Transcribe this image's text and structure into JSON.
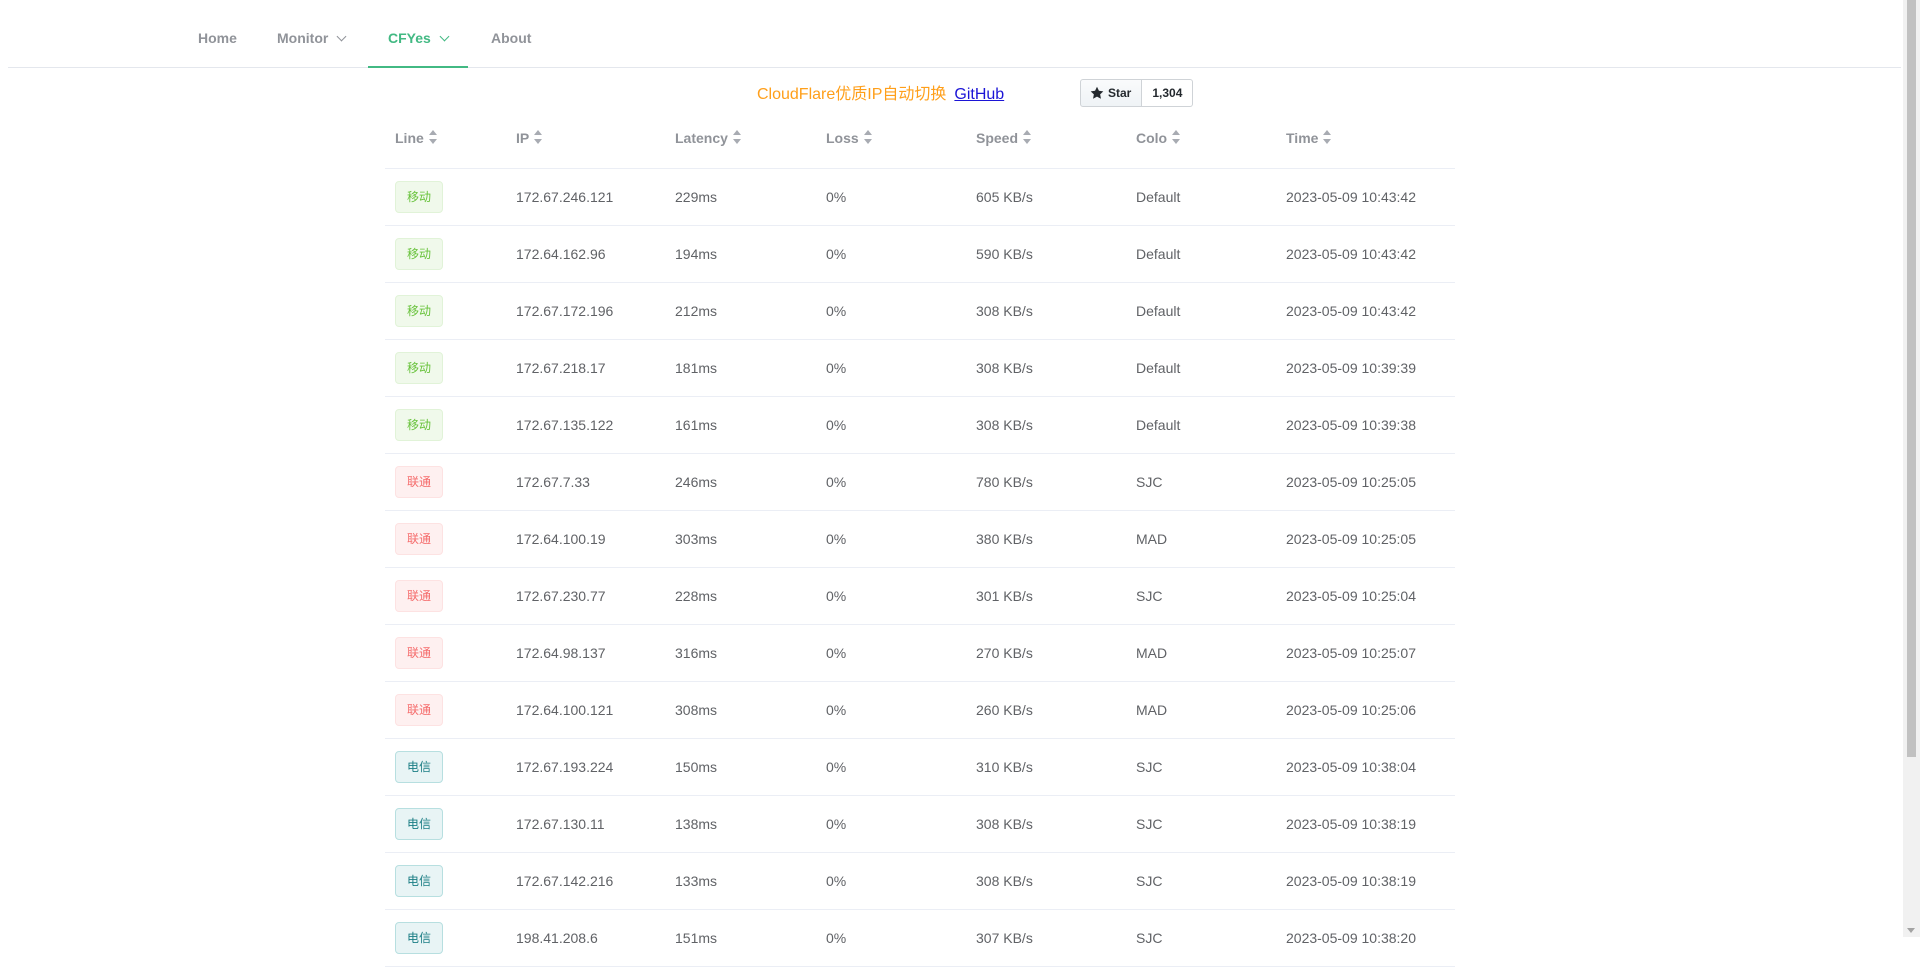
{
  "nav": {
    "items": [
      {
        "label": "Home",
        "dropdown": false,
        "active": false
      },
      {
        "label": "Monitor",
        "dropdown": true,
        "active": false
      },
      {
        "label": "CFYes",
        "dropdown": true,
        "active": true
      },
      {
        "label": "About",
        "dropdown": false,
        "active": false
      }
    ]
  },
  "header": {
    "title": "CloudFlare优质IP自动切换",
    "github_link": "GitHub",
    "star_label": "Star",
    "star_count": "1,304"
  },
  "colors": {
    "accent": "#42b983",
    "title": "#ff9f1a",
    "tag_green": "#67c23a",
    "tag_red": "#f56c6c",
    "tag_teal": "#1a7d84"
  },
  "table": {
    "columns": [
      "Line",
      "IP",
      "Latency",
      "Loss",
      "Speed",
      "Colo",
      "Time"
    ],
    "rows": [
      {
        "line": "移动",
        "tag": "green",
        "ip": "172.67.246.121",
        "latency": "229ms",
        "loss": "0%",
        "speed": "605 KB/s",
        "colo": "Default",
        "time": "2023-05-09 10:43:42"
      },
      {
        "line": "移动",
        "tag": "green",
        "ip": "172.64.162.96",
        "latency": "194ms",
        "loss": "0%",
        "speed": "590 KB/s",
        "colo": "Default",
        "time": "2023-05-09 10:43:42"
      },
      {
        "line": "移动",
        "tag": "green",
        "ip": "172.67.172.196",
        "latency": "212ms",
        "loss": "0%",
        "speed": "308 KB/s",
        "colo": "Default",
        "time": "2023-05-09 10:43:42"
      },
      {
        "line": "移动",
        "tag": "green",
        "ip": "172.67.218.17",
        "latency": "181ms",
        "loss": "0%",
        "speed": "308 KB/s",
        "colo": "Default",
        "time": "2023-05-09 10:39:39"
      },
      {
        "line": "移动",
        "tag": "green",
        "ip": "172.67.135.122",
        "latency": "161ms",
        "loss": "0%",
        "speed": "308 KB/s",
        "colo": "Default",
        "time": "2023-05-09 10:39:38"
      },
      {
        "line": "联通",
        "tag": "red",
        "ip": "172.67.7.33",
        "latency": "246ms",
        "loss": "0%",
        "speed": "780 KB/s",
        "colo": "SJC",
        "time": "2023-05-09 10:25:05"
      },
      {
        "line": "联通",
        "tag": "red",
        "ip": "172.64.100.19",
        "latency": "303ms",
        "loss": "0%",
        "speed": "380 KB/s",
        "colo": "MAD",
        "time": "2023-05-09 10:25:05"
      },
      {
        "line": "联通",
        "tag": "red",
        "ip": "172.67.230.77",
        "latency": "228ms",
        "loss": "0%",
        "speed": "301 KB/s",
        "colo": "SJC",
        "time": "2023-05-09 10:25:04"
      },
      {
        "line": "联通",
        "tag": "red",
        "ip": "172.64.98.137",
        "latency": "316ms",
        "loss": "0%",
        "speed": "270 KB/s",
        "colo": "MAD",
        "time": "2023-05-09 10:25:07"
      },
      {
        "line": "联通",
        "tag": "red",
        "ip": "172.64.100.121",
        "latency": "308ms",
        "loss": "0%",
        "speed": "260 KB/s",
        "colo": "MAD",
        "time": "2023-05-09 10:25:06"
      },
      {
        "line": "电信",
        "tag": "teal",
        "ip": "172.67.193.224",
        "latency": "150ms",
        "loss": "0%",
        "speed": "310 KB/s",
        "colo": "SJC",
        "time": "2023-05-09 10:38:04"
      },
      {
        "line": "电信",
        "tag": "teal",
        "ip": "172.67.130.11",
        "latency": "138ms",
        "loss": "0%",
        "speed": "308 KB/s",
        "colo": "SJC",
        "time": "2023-05-09 10:38:19"
      },
      {
        "line": "电信",
        "tag": "teal",
        "ip": "172.67.142.216",
        "latency": "133ms",
        "loss": "0%",
        "speed": "308 KB/s",
        "colo": "SJC",
        "time": "2023-05-09 10:38:19"
      },
      {
        "line": "电信",
        "tag": "teal",
        "ip": "198.41.208.6",
        "latency": "151ms",
        "loss": "0%",
        "speed": "307 KB/s",
        "colo": "SJC",
        "time": "2023-05-09 10:38:20"
      }
    ]
  }
}
